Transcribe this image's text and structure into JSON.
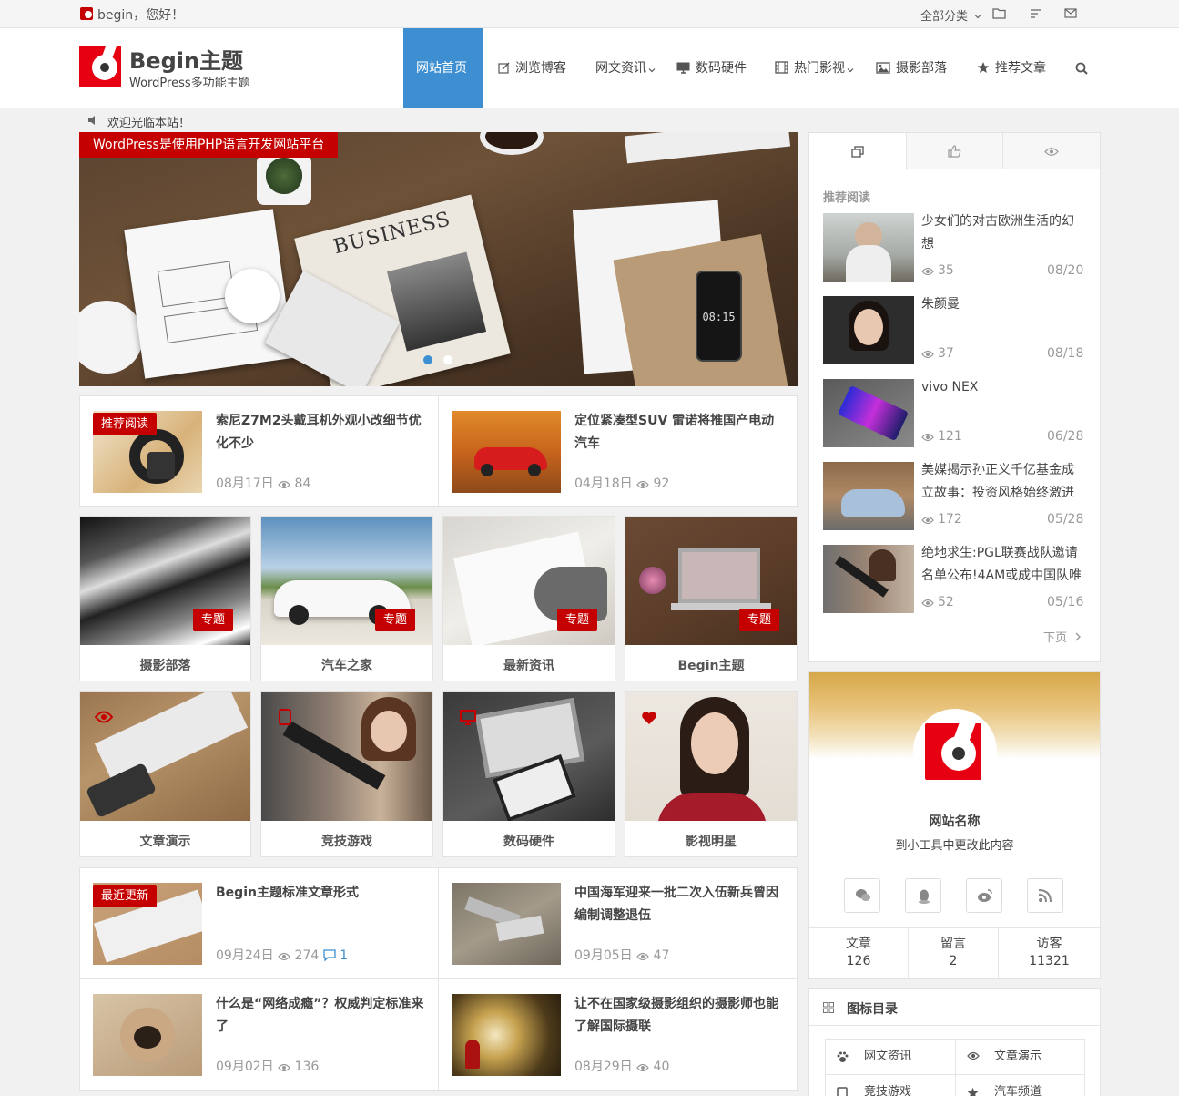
{
  "topbar": {
    "greeting": "begin，您好！",
    "all_categories": "全部分类"
  },
  "brand": {
    "name": "Begin主题",
    "tagline": "WordPress多功能主题"
  },
  "nav": {
    "items": [
      "网站首页",
      "浏览博客",
      "网文资讯",
      "数码硬件",
      "热门影视",
      "摄影部落",
      "推荐文章"
    ],
    "active": "网站首页"
  },
  "notice": "欢迎光临本站！",
  "slider": {
    "caption": "WordPress是使用PHP语言开发网站平台",
    "phone_time": "08:15",
    "newspaper_text": "BUSINESS"
  },
  "featured": [
    {
      "tag": "推荐阅读",
      "title": "索尼Z7M2头戴耳机外观小改细节优化不少",
      "date": "08月17日",
      "views": "84"
    },
    {
      "tag": "",
      "title": "定位紧凑型SUV 雷诺将推国产电动汽车",
      "date": "04月18日",
      "views": "92"
    }
  ],
  "special_tag": "专题",
  "grid_row1": [
    "摄影部落",
    "汽车之家",
    "最新资讯",
    "Begin主题"
  ],
  "grid_row2": [
    "文章演示",
    "竞技游戏",
    "数码硬件",
    "影视明星"
  ],
  "latest": [
    {
      "tag": "最近更新",
      "title": "Begin主题标准文章形式",
      "date": "09月24日",
      "views": "274",
      "comments": "1"
    },
    {
      "tag": "",
      "title": "中国海军迎来一批二次入伍新兵曾因编制调整退伍",
      "date": "09月05日",
      "views": "47"
    },
    {
      "tag": "",
      "title": "什么是“网络成瘾”？权威判定标准来了",
      "date": "09月02日",
      "views": "136"
    },
    {
      "tag": "",
      "title": "让不在国家级摄影组织的摄影师也能了解国际摄联",
      "date": "08月29日",
      "views": "40"
    }
  ],
  "sidebar": {
    "section_title": "推荐阅读",
    "items": [
      {
        "title": "少女们的对古欧洲生活的幻想",
        "views": "35",
        "date": "08/20"
      },
      {
        "title": "朱颜曼",
        "views": "37",
        "date": "08/18"
      },
      {
        "title": "vivo NEX",
        "views": "121",
        "date": "06/28"
      },
      {
        "title": "美媒揭示孙正义千亿基金成立故事：投资风格始终激进",
        "views": "172",
        "date": "05/28"
      },
      {
        "title": "绝地求生:PGL联赛战队邀请名单公布!4AM或成中国队唯",
        "views": "52",
        "date": "05/16"
      }
    ],
    "next": "下页",
    "about": {
      "name": "网站名称",
      "desc": "到小工具中更改此内容"
    },
    "stats": [
      {
        "label": "文章",
        "value": "126"
      },
      {
        "label": "留言",
        "value": "2"
      },
      {
        "label": "访客",
        "value": "11321"
      }
    ],
    "dir_title": "图标目录",
    "dir_items": [
      "网文资讯",
      "文章演示",
      "竞技游戏",
      "汽车频道"
    ]
  },
  "colors": {
    "accent": "#c40000",
    "nav_active": "#3d8fd1"
  }
}
